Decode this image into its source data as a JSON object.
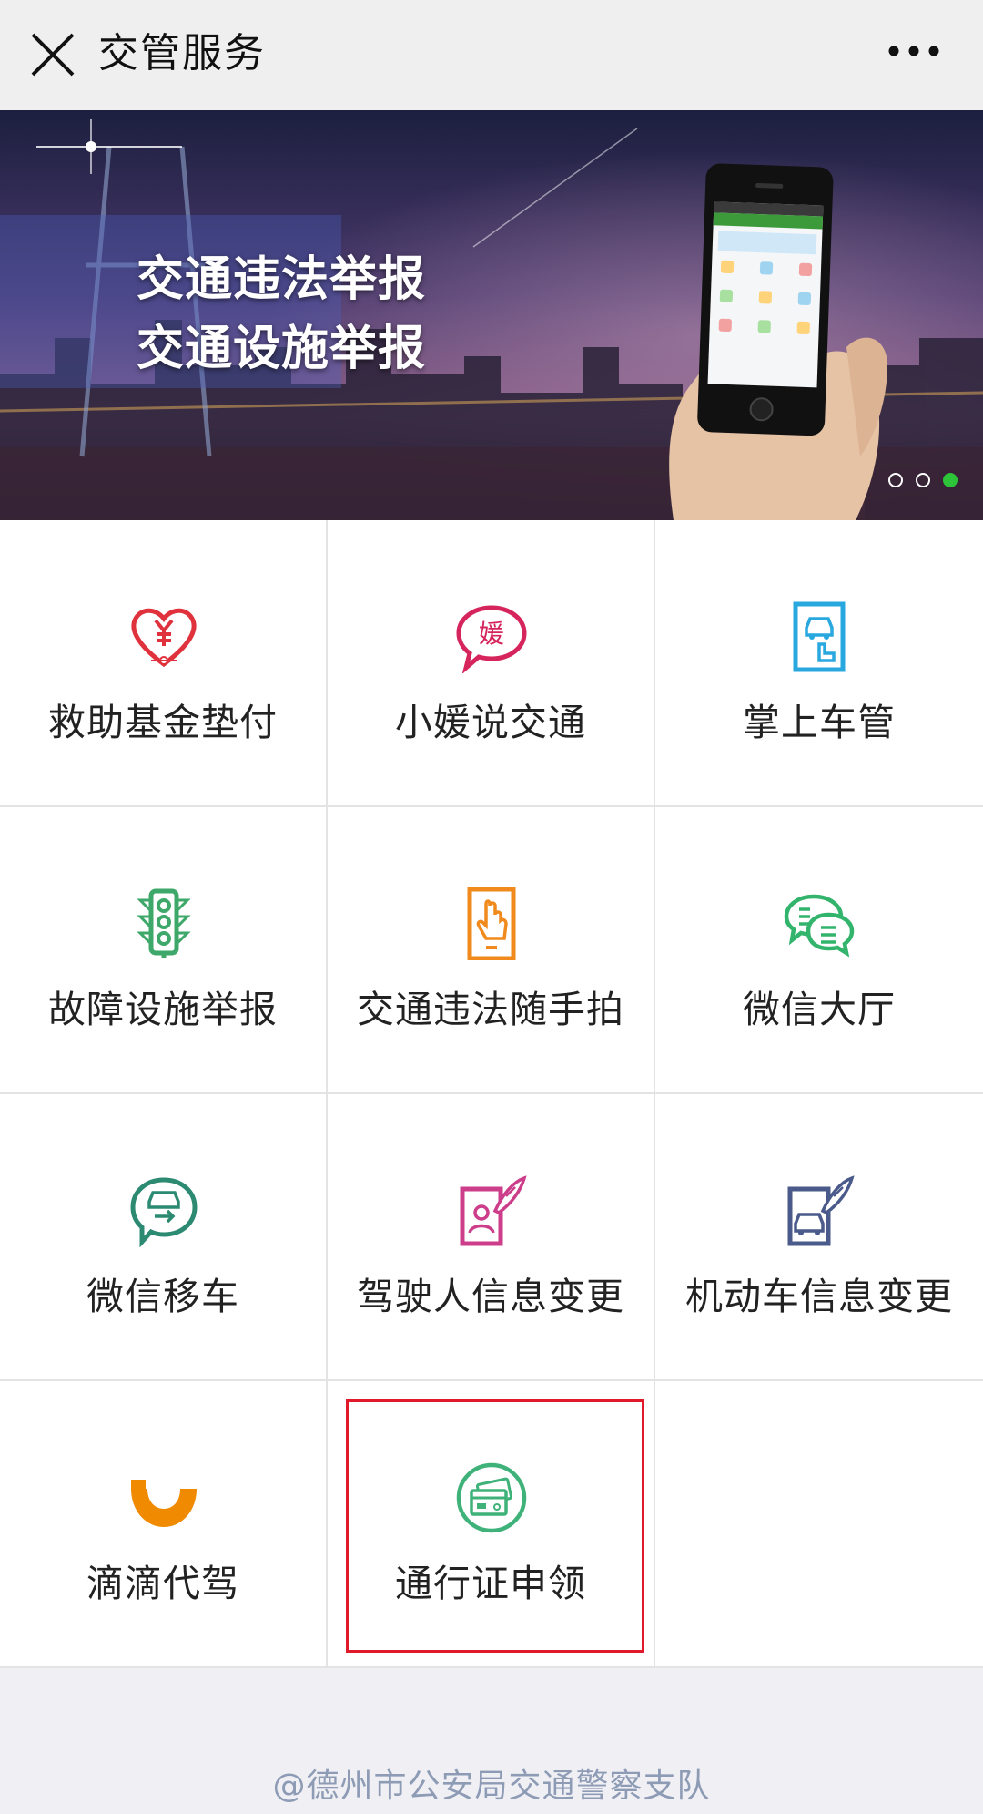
{
  "app": {
    "title": "交管服务"
  },
  "banner": {
    "line1": "交通违法举报",
    "line2": "交通设施举报",
    "slide_count": 3,
    "active_slide": 3
  },
  "grid": {
    "items": [
      {
        "label": "救助基金垫付",
        "icon": "heart-yen-icon",
        "color": "#e0323d"
      },
      {
        "label": "小媛说交通",
        "icon": "chat-bubble-yuan-icon",
        "color": "#d6245d"
      },
      {
        "label": "掌上车管",
        "icon": "phone-car-icon",
        "color": "#29a8e0"
      },
      {
        "label": "故障设施举报",
        "icon": "traffic-light-icon",
        "color": "#3ea86a"
      },
      {
        "label": "交通违法随手拍",
        "icon": "phone-hand-icon",
        "color": "#f08a1c"
      },
      {
        "label": "微信大厅",
        "icon": "chat-bubbles-icon",
        "color": "#32b46c"
      },
      {
        "label": "微信移车",
        "icon": "car-move-icon",
        "color": "#2c8a73"
      },
      {
        "label": "驾驶人信息变更",
        "icon": "driver-edit-icon",
        "color": "#cc3d8a"
      },
      {
        "label": "机动车信息变更",
        "icon": "vehicle-edit-icon",
        "color": "#4a5a8a"
      },
      {
        "label": "滴滴代驾",
        "icon": "didi-icon",
        "color": "#f08a00"
      },
      {
        "label": "通行证申领",
        "icon": "pass-card-icon",
        "color": "#3fb27a"
      }
    ]
  },
  "footer": {
    "text": "@德州市公安局交通警察支队"
  },
  "colors": {
    "highlight": "#e0192b",
    "active_dot": "#2dc43a"
  }
}
